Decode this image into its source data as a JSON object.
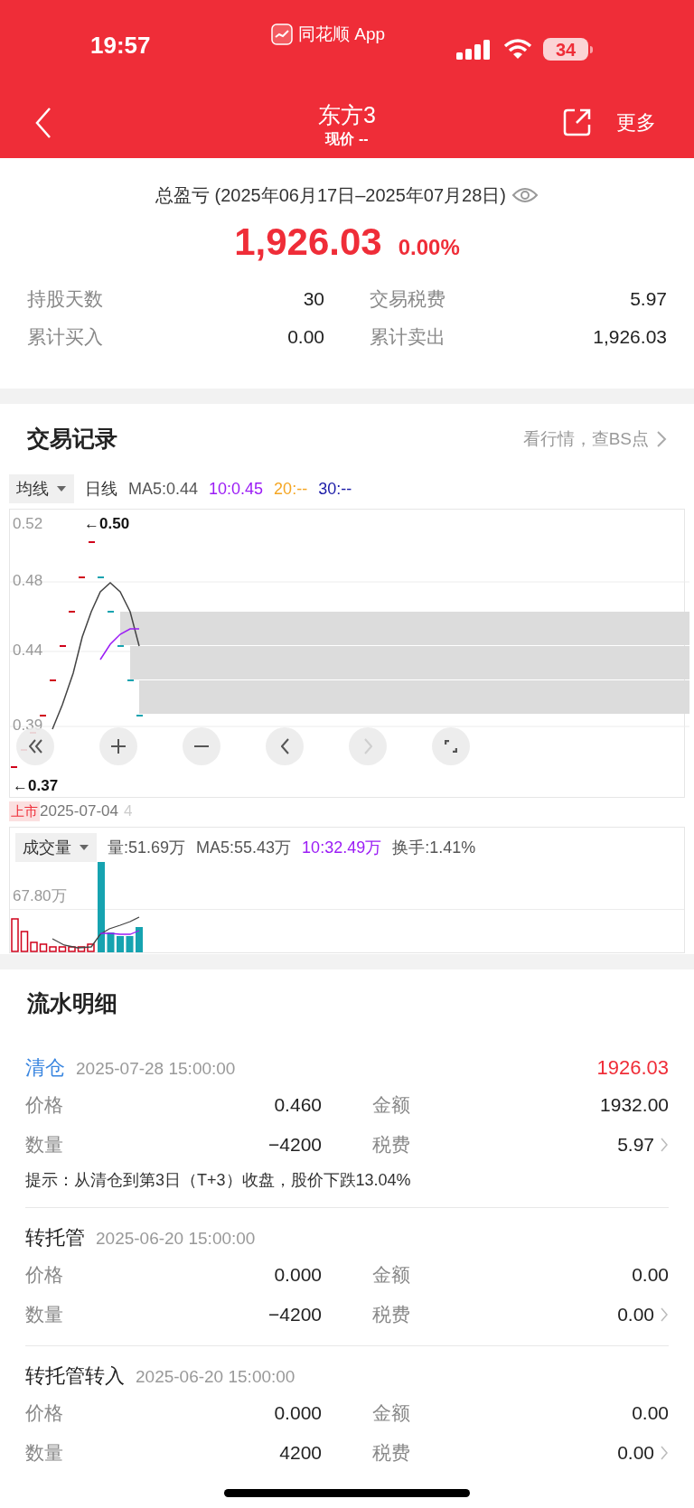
{
  "status_bar": {
    "time": "19:57",
    "app_name": "同花顺 App",
    "battery": "34"
  },
  "nav": {
    "title": "东方3",
    "subtitle": "现价 --",
    "more": "更多"
  },
  "summary": {
    "title": "总盈亏 (2025年06月17日–2025年07月28日)",
    "value": "1,926.03",
    "percent": "0.00%",
    "stats": [
      {
        "label": "持股天数",
        "value": "30"
      },
      {
        "label": "交易税费",
        "value": "5.97"
      },
      {
        "label": "累计买入",
        "value": "0.00"
      },
      {
        "label": "累计卖出",
        "value": "1,926.03"
      }
    ]
  },
  "trade_records": {
    "title": "交易记录",
    "link": "看行情，查BS点",
    "price_chart": {
      "selector": "均线",
      "period": "日线",
      "ma_labels": [
        {
          "text": "MA5:0.44",
          "color": "#555555"
        },
        {
          "text": "10:0.45",
          "color": "#9b1cf5"
        },
        {
          "text": "20:--",
          "color": "#f5a623"
        },
        {
          "text": "30:--",
          "color": "#1c1ca8"
        }
      ],
      "y_labels": [
        "0.52",
        "0.48",
        "0.44",
        "0.39"
      ],
      "high_marker": "←0.50",
      "low_marker": "←0.37",
      "controls": [
        {
          "kind": "first",
          "disabled": false
        },
        {
          "kind": "zoom_in",
          "disabled": false
        },
        {
          "kind": "zoom_out",
          "disabled": false
        },
        {
          "kind": "prev",
          "disabled": false
        },
        {
          "kind": "next",
          "disabled": true
        },
        {
          "kind": "fullscreen",
          "disabled": false
        }
      ],
      "listing_tag": "上市",
      "date": "2025-07-04",
      "date_tail": "4"
    },
    "volume_chart": {
      "selector": "成交量",
      "labels": [
        {
          "text": "量:51.69万",
          "color": "#555555"
        },
        {
          "text": "MA5:55.43万",
          "color": "#555555"
        },
        {
          "text": "10:32.49万",
          "color": "#9b1cf5"
        },
        {
          "text": "换手:1.41%",
          "color": "#555555"
        }
      ],
      "y_label": "67.80万"
    }
  },
  "flow": {
    "title": "流水明细",
    "records": [
      {
        "action": "清仓",
        "color": "#3a86e0",
        "time": "2025-07-28 15:00:00",
        "amount": "1926.03",
        "fields": [
          {
            "label": "价格",
            "value": "0.460"
          },
          {
            "label": "金额",
            "value": "1932.00"
          },
          {
            "label": "数量",
            "value": "−4200"
          },
          {
            "label": "税费",
            "value": "5.97"
          }
        ],
        "tip": "提示：从清仓到第3日（T+3）收盘，股价下跌13.04%"
      },
      {
        "action": "转托管",
        "color": "#222222",
        "time": "2025-06-20 15:00:00",
        "fields": [
          {
            "label": "价格",
            "value": "0.000"
          },
          {
            "label": "金额",
            "value": "0.00"
          },
          {
            "label": "数量",
            "value": "−4200"
          },
          {
            "label": "税费",
            "value": "0.00"
          }
        ]
      },
      {
        "action": "转托管转入",
        "color": "#222222",
        "time": "2025-06-20 15:00:00",
        "fields": [
          {
            "label": "价格",
            "value": "0.000"
          },
          {
            "label": "金额",
            "value": "0.00"
          },
          {
            "label": "数量",
            "value": "4200"
          },
          {
            "label": "税费",
            "value": "0.00"
          }
        ]
      }
    ]
  }
}
